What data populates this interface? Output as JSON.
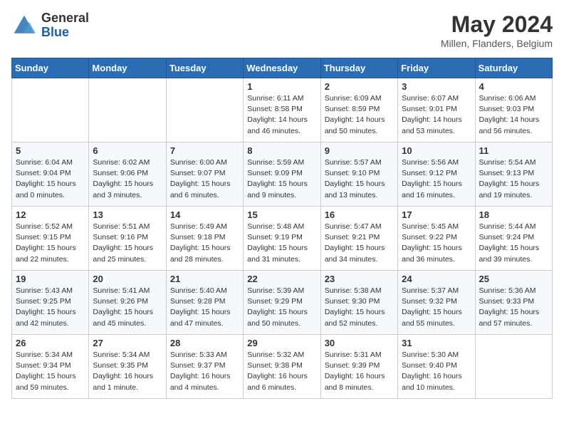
{
  "header": {
    "logo_general": "General",
    "logo_blue": "Blue",
    "month_year": "May 2024",
    "location": "Millen, Flanders, Belgium"
  },
  "weekdays": [
    "Sunday",
    "Monday",
    "Tuesday",
    "Wednesday",
    "Thursday",
    "Friday",
    "Saturday"
  ],
  "weeks": [
    [
      {
        "day": "",
        "info": ""
      },
      {
        "day": "",
        "info": ""
      },
      {
        "day": "",
        "info": ""
      },
      {
        "day": "1",
        "info": "Sunrise: 6:11 AM\nSunset: 8:58 PM\nDaylight: 14 hours\nand 46 minutes."
      },
      {
        "day": "2",
        "info": "Sunrise: 6:09 AM\nSunset: 8:59 PM\nDaylight: 14 hours\nand 50 minutes."
      },
      {
        "day": "3",
        "info": "Sunrise: 6:07 AM\nSunset: 9:01 PM\nDaylight: 14 hours\nand 53 minutes."
      },
      {
        "day": "4",
        "info": "Sunrise: 6:06 AM\nSunset: 9:03 PM\nDaylight: 14 hours\nand 56 minutes."
      }
    ],
    [
      {
        "day": "5",
        "info": "Sunrise: 6:04 AM\nSunset: 9:04 PM\nDaylight: 15 hours\nand 0 minutes."
      },
      {
        "day": "6",
        "info": "Sunrise: 6:02 AM\nSunset: 9:06 PM\nDaylight: 15 hours\nand 3 minutes."
      },
      {
        "day": "7",
        "info": "Sunrise: 6:00 AM\nSunset: 9:07 PM\nDaylight: 15 hours\nand 6 minutes."
      },
      {
        "day": "8",
        "info": "Sunrise: 5:59 AM\nSunset: 9:09 PM\nDaylight: 15 hours\nand 9 minutes."
      },
      {
        "day": "9",
        "info": "Sunrise: 5:57 AM\nSunset: 9:10 PM\nDaylight: 15 hours\nand 13 minutes."
      },
      {
        "day": "10",
        "info": "Sunrise: 5:56 AM\nSunset: 9:12 PM\nDaylight: 15 hours\nand 16 minutes."
      },
      {
        "day": "11",
        "info": "Sunrise: 5:54 AM\nSunset: 9:13 PM\nDaylight: 15 hours\nand 19 minutes."
      }
    ],
    [
      {
        "day": "12",
        "info": "Sunrise: 5:52 AM\nSunset: 9:15 PM\nDaylight: 15 hours\nand 22 minutes."
      },
      {
        "day": "13",
        "info": "Sunrise: 5:51 AM\nSunset: 9:16 PM\nDaylight: 15 hours\nand 25 minutes."
      },
      {
        "day": "14",
        "info": "Sunrise: 5:49 AM\nSunset: 9:18 PM\nDaylight: 15 hours\nand 28 minutes."
      },
      {
        "day": "15",
        "info": "Sunrise: 5:48 AM\nSunset: 9:19 PM\nDaylight: 15 hours\nand 31 minutes."
      },
      {
        "day": "16",
        "info": "Sunrise: 5:47 AM\nSunset: 9:21 PM\nDaylight: 15 hours\nand 34 minutes."
      },
      {
        "day": "17",
        "info": "Sunrise: 5:45 AM\nSunset: 9:22 PM\nDaylight: 15 hours\nand 36 minutes."
      },
      {
        "day": "18",
        "info": "Sunrise: 5:44 AM\nSunset: 9:24 PM\nDaylight: 15 hours\nand 39 minutes."
      }
    ],
    [
      {
        "day": "19",
        "info": "Sunrise: 5:43 AM\nSunset: 9:25 PM\nDaylight: 15 hours\nand 42 minutes."
      },
      {
        "day": "20",
        "info": "Sunrise: 5:41 AM\nSunset: 9:26 PM\nDaylight: 15 hours\nand 45 minutes."
      },
      {
        "day": "21",
        "info": "Sunrise: 5:40 AM\nSunset: 9:28 PM\nDaylight: 15 hours\nand 47 minutes."
      },
      {
        "day": "22",
        "info": "Sunrise: 5:39 AM\nSunset: 9:29 PM\nDaylight: 15 hours\nand 50 minutes."
      },
      {
        "day": "23",
        "info": "Sunrise: 5:38 AM\nSunset: 9:30 PM\nDaylight: 15 hours\nand 52 minutes."
      },
      {
        "day": "24",
        "info": "Sunrise: 5:37 AM\nSunset: 9:32 PM\nDaylight: 15 hours\nand 55 minutes."
      },
      {
        "day": "25",
        "info": "Sunrise: 5:36 AM\nSunset: 9:33 PM\nDaylight: 15 hours\nand 57 minutes."
      }
    ],
    [
      {
        "day": "26",
        "info": "Sunrise: 5:34 AM\nSunset: 9:34 PM\nDaylight: 15 hours\nand 59 minutes."
      },
      {
        "day": "27",
        "info": "Sunrise: 5:34 AM\nSunset: 9:35 PM\nDaylight: 16 hours\nand 1 minute."
      },
      {
        "day": "28",
        "info": "Sunrise: 5:33 AM\nSunset: 9:37 PM\nDaylight: 16 hours\nand 4 minutes."
      },
      {
        "day": "29",
        "info": "Sunrise: 5:32 AM\nSunset: 9:38 PM\nDaylight: 16 hours\nand 6 minutes."
      },
      {
        "day": "30",
        "info": "Sunrise: 5:31 AM\nSunset: 9:39 PM\nDaylight: 16 hours\nand 8 minutes."
      },
      {
        "day": "31",
        "info": "Sunrise: 5:30 AM\nSunset: 9:40 PM\nDaylight: 16 hours\nand 10 minutes."
      },
      {
        "day": "",
        "info": ""
      }
    ]
  ]
}
